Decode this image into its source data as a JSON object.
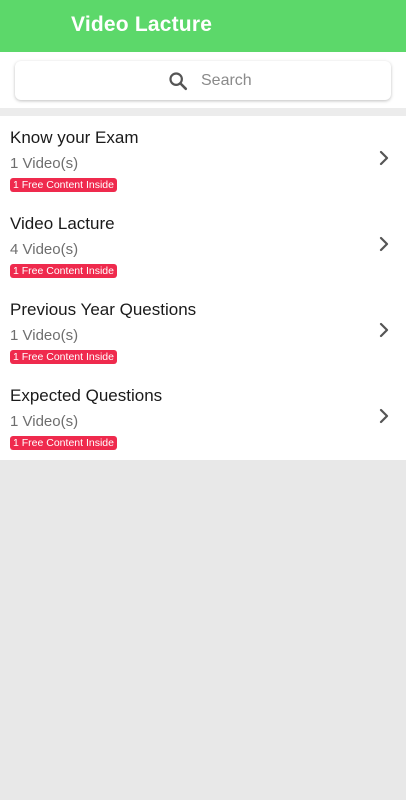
{
  "header": {
    "title": "Video Lacture"
  },
  "search": {
    "placeholder": "Search"
  },
  "items": [
    {
      "title": "Know your Exam",
      "count": "1 Video(s)",
      "badge": "1 Free Content Inside"
    },
    {
      "title": "Video Lacture",
      "count": "4 Video(s)",
      "badge": "1 Free Content Inside"
    },
    {
      "title": "Previous Year Questions",
      "count": "1 Video(s)",
      "badge": "1 Free Content Inside"
    },
    {
      "title": "Expected Questions",
      "count": "1 Video(s)",
      "badge": "1 Free Content Inside"
    }
  ],
  "colors": {
    "app_bar": "#5cd86a",
    "badge": "#ef2a4d",
    "background": "#e8e8e8"
  },
  "icons": {
    "search": "search-icon",
    "chevron": "chevron-right-icon"
  }
}
